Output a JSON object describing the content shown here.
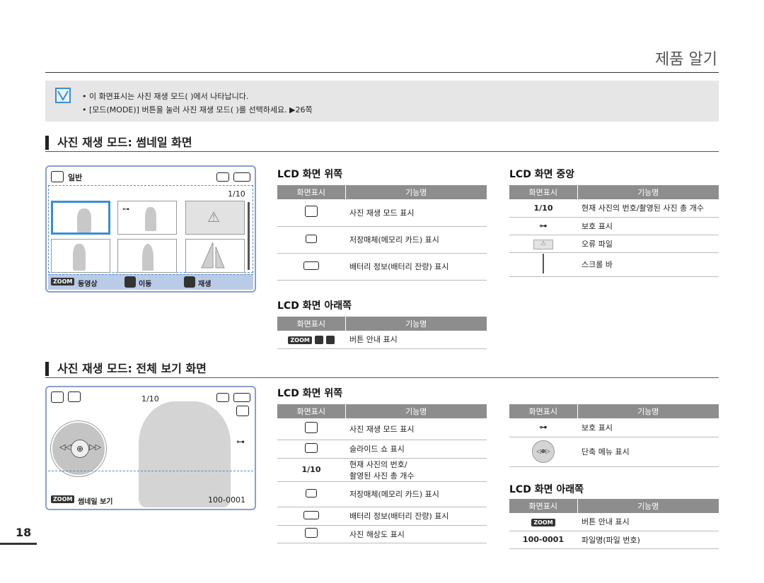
{
  "page_title": "제품 알기",
  "page_number": "18",
  "note": {
    "line1": "• 이 화면표시는 사진 재생 모드(  )에서 나타납니다.",
    "line2": "• [모드(MODE)] 버튼을 눌러 사진 재생 모드(  )를 선택하세요. ▶26쪽"
  },
  "section1": {
    "title": "사진 재생 모드: 썸네일 화면",
    "lcd": {
      "mode_label": "일반",
      "counter": "1/10",
      "bottom_zoom": "ZOOM",
      "bottom_1": "동영상",
      "bottom_2": "이동",
      "bottom_3": "재생"
    },
    "top_table": {
      "title": "LCD 화면 위쪽",
      "headers": [
        "화면표시",
        "기능명"
      ],
      "rows": [
        "사진 재생 모드 표시",
        "저장매체(메모리 카드) 표시",
        "배터리 정보(배터리 잔량) 표시"
      ]
    },
    "middle_table": {
      "title": "LCD 화면 중앙",
      "headers": [
        "화면표시",
        "기능명"
      ],
      "rows": [
        {
          "icon": "1/10",
          "text": "현재 사진의 번호/촬영된 사진 총 개수"
        },
        {
          "icon": "key-icon",
          "text": "보호 표시"
        },
        {
          "icon": "warning-icon",
          "text": "오류 파일"
        },
        {
          "icon": "scrollbar-icon",
          "text": "스크롤 바"
        }
      ]
    },
    "bottom_table": {
      "title": "LCD 화면 아래쪽",
      "headers": [
        "화면표시",
        "기능명"
      ],
      "rows": [
        "버튼 안내 표시"
      ]
    }
  },
  "section2": {
    "title": "사진 재생 모드: 전체 보기 화면",
    "lcd": {
      "counter": "1/10",
      "bottom_zoom": "ZOOM",
      "bottom_label": "썸네일 보기",
      "file_no": "100-0001"
    },
    "top_table": {
      "title": "LCD 화면 위쪽",
      "headers": [
        "화면표시",
        "기능명"
      ],
      "rows": [
        {
          "icon": "photo-mode-icon",
          "text": "사진 재생 모드 표시"
        },
        {
          "icon": "slideshow-icon",
          "text": "슬라이드 쇼 표시"
        },
        {
          "icon": "1/10",
          "text": "현재 사진의 번호/ 촬영된 사진 총 개수",
          "text_a": "현재 사진의 번호/",
          "text_b": "촬영된 사진 총 개수"
        },
        {
          "icon": "card-icon",
          "text": "저장매체(메모리 카드) 표시"
        },
        {
          "icon": "battery-icon",
          "text": "배터리 정보(배터리 잔량) 표시"
        },
        {
          "icon": "resolution-icon",
          "text": "사진 해상도 표시"
        }
      ]
    },
    "right_table": {
      "headers": [
        "화면표시",
        "기능명"
      ],
      "rows": [
        "보호 표시",
        "단축 메뉴 표시"
      ]
    },
    "bottom_table": {
      "title": "LCD 화면 아래쪽",
      "headers": [
        "화면표시",
        "기능명"
      ],
      "rows": [
        {
          "icon": "ZOOM",
          "text": "버튼 안내 표시"
        },
        {
          "icon": "100-0001",
          "text": "파일명(파일 번호)"
        }
      ]
    }
  }
}
